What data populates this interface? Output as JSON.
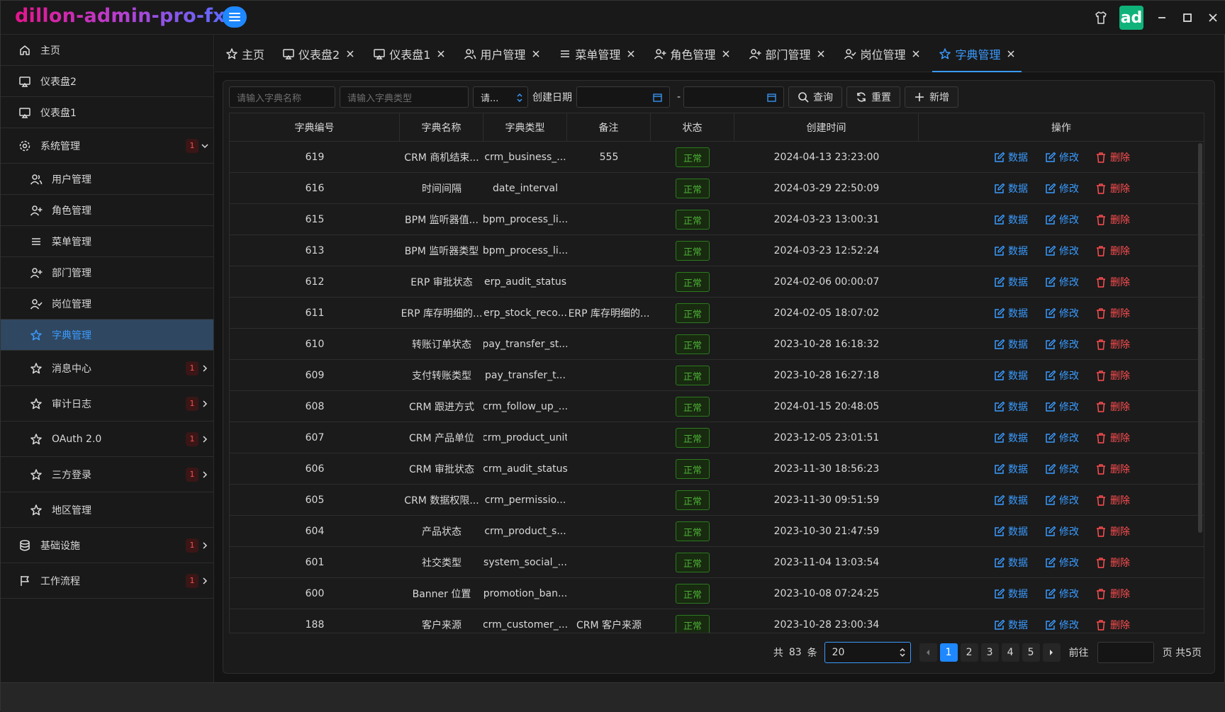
{
  "app": {
    "title": "dillon-admin-pro-fx",
    "avatar_text": "ad"
  },
  "sidebar": {
    "items": [
      {
        "label": "主页",
        "icon": "home-icon",
        "level": 1
      },
      {
        "label": "仪表盘2",
        "icon": "monitor-icon",
        "level": 1
      },
      {
        "label": "仪表盘1",
        "icon": "monitor-icon",
        "level": 1
      },
      {
        "label": "系统管理",
        "icon": "gear-icon",
        "level": 1,
        "badge": "1",
        "arrow": "down",
        "tall": true
      },
      {
        "label": "用户管理",
        "icon": "users-icon",
        "level": 2
      },
      {
        "label": "角色管理",
        "icon": "user-plus-icon",
        "level": 2
      },
      {
        "label": "菜单管理",
        "icon": "menu-icon",
        "level": 2
      },
      {
        "label": "部门管理",
        "icon": "user-plus-icon",
        "level": 2
      },
      {
        "label": "岗位管理",
        "icon": "user-check-icon",
        "level": 2
      },
      {
        "label": "字典管理",
        "icon": "star-icon",
        "level": 2,
        "active": true
      },
      {
        "label": "消息中心",
        "icon": "star-icon",
        "level": 2,
        "badge": "1",
        "arrow": "right",
        "tall": true
      },
      {
        "label": "审计日志",
        "icon": "star-icon",
        "level": 2,
        "badge": "1",
        "arrow": "right",
        "tall": true
      },
      {
        "label": "OAuth 2.0",
        "icon": "star-icon",
        "level": 2,
        "badge": "1",
        "arrow": "right",
        "tall": true
      },
      {
        "label": "三方登录",
        "icon": "star-icon",
        "level": 2,
        "badge": "1",
        "arrow": "right",
        "tall": true
      },
      {
        "label": "地区管理",
        "icon": "star-icon",
        "level": 2,
        "tall": true
      },
      {
        "label": "基础设施",
        "icon": "database-icon",
        "level": 1,
        "badge": "1",
        "arrow": "right",
        "tall": true
      },
      {
        "label": "工作流程",
        "icon": "flag-icon",
        "level": 1,
        "badge": "1",
        "arrow": "right",
        "tall": true
      }
    ]
  },
  "tabs": [
    {
      "label": "主页",
      "icon": "star-icon",
      "closable": false
    },
    {
      "label": "仪表盘2",
      "icon": "monitor-icon",
      "closable": true
    },
    {
      "label": "仪表盘1",
      "icon": "monitor-icon",
      "closable": true
    },
    {
      "label": "用户管理",
      "icon": "users-icon",
      "closable": true
    },
    {
      "label": "菜单管理",
      "icon": "menu-icon",
      "closable": true
    },
    {
      "label": "角色管理",
      "icon": "user-plus-icon",
      "closable": true
    },
    {
      "label": "部门管理",
      "icon": "user-plus-icon",
      "closable": true
    },
    {
      "label": "岗位管理",
      "icon": "user-check-icon",
      "closable": true
    },
    {
      "label": "字典管理",
      "icon": "star-icon",
      "closable": true,
      "active": true
    }
  ],
  "filters": {
    "dict_name_placeholder": "请输入字典名称",
    "dict_type_placeholder": "请输入字典类型",
    "status_value": "请...",
    "date_label": "创建日期",
    "date_separator": "-",
    "search_label": "查询",
    "reset_label": "重置",
    "add_label": "新增"
  },
  "table": {
    "headers": [
      "字典编号",
      "字典名称",
      "字典类型",
      "备注",
      "状态",
      "创建时间",
      "操作"
    ],
    "action_labels": {
      "data": "数据",
      "edit": "修改",
      "delete": "删除"
    },
    "rows": [
      {
        "id": "619",
        "name": "CRM 商机结束...",
        "type": "crm_business_...",
        "remark": "555",
        "status": "正常",
        "created": "2024-04-13 23:23:00"
      },
      {
        "id": "616",
        "name": "时间间隔",
        "type": "date_interval",
        "remark": "",
        "status": "正常",
        "created": "2024-03-29 22:50:09"
      },
      {
        "id": "615",
        "name": "BPM 监听器值...",
        "type": "bpm_process_li...",
        "remark": "",
        "status": "正常",
        "created": "2024-03-23 13:00:31"
      },
      {
        "id": "613",
        "name": "BPM 监听器类型",
        "type": "bpm_process_li...",
        "remark": "",
        "status": "正常",
        "created": "2024-03-23 12:52:24"
      },
      {
        "id": "612",
        "name": "ERP 审批状态",
        "type": "erp_audit_status",
        "remark": "",
        "status": "正常",
        "created": "2024-02-06 00:00:07"
      },
      {
        "id": "611",
        "name": "ERP 库存明细的...",
        "type": "erp_stock_reco...",
        "remark": "ERP 库存明细的...",
        "status": "正常",
        "created": "2024-02-05 18:07:02"
      },
      {
        "id": "610",
        "name": "转账订单状态",
        "type": "pay_transfer_st...",
        "remark": "",
        "status": "正常",
        "created": "2023-10-28 16:18:32"
      },
      {
        "id": "609",
        "name": "支付转账类型",
        "type": "pay_transfer_t...",
        "remark": "",
        "status": "正常",
        "created": "2023-10-28 16:27:18"
      },
      {
        "id": "608",
        "name": "CRM 跟进方式",
        "type": "crm_follow_up_...",
        "remark": "",
        "status": "正常",
        "created": "2024-01-15 20:48:05"
      },
      {
        "id": "607",
        "name": "CRM 产品单位",
        "type": "crm_product_unit",
        "remark": "",
        "status": "正常",
        "created": "2023-12-05 23:01:51"
      },
      {
        "id": "606",
        "name": "CRM 审批状态",
        "type": "crm_audit_status",
        "remark": "",
        "status": "正常",
        "created": "2023-11-30 18:56:23"
      },
      {
        "id": "605",
        "name": "CRM 数据权限...",
        "type": "crm_permissio...",
        "remark": "",
        "status": "正常",
        "created": "2023-11-30 09:51:59"
      },
      {
        "id": "604",
        "name": "产品状态",
        "type": "crm_product_s...",
        "remark": "",
        "status": "正常",
        "created": "2023-10-30 21:47:59"
      },
      {
        "id": "601",
        "name": "社交类型",
        "type": "system_social_...",
        "remark": "",
        "status": "正常",
        "created": "2023-11-04 13:03:54"
      },
      {
        "id": "600",
        "name": "Banner 位置",
        "type": "promotion_ban...",
        "remark": "",
        "status": "正常",
        "created": "2023-10-08 07:24:25"
      },
      {
        "id": "188",
        "name": "客户来源",
        "type": "crm_customer_...",
        "remark": "CRM 客户来源",
        "status": "正常",
        "created": "2023-10-28 23:00:34"
      }
    ]
  },
  "pagination": {
    "total_prefix": "共",
    "total": "83",
    "total_suffix": "条",
    "page_size": "20",
    "pages": [
      "1",
      "2",
      "3",
      "4",
      "5"
    ],
    "current": "1",
    "goto_label": "前往",
    "page_suffix": "页 共5页"
  },
  "colors": {
    "accent": "#1e88ff",
    "status_ok": "#4caf36",
    "danger": "#ff4d4f"
  }
}
